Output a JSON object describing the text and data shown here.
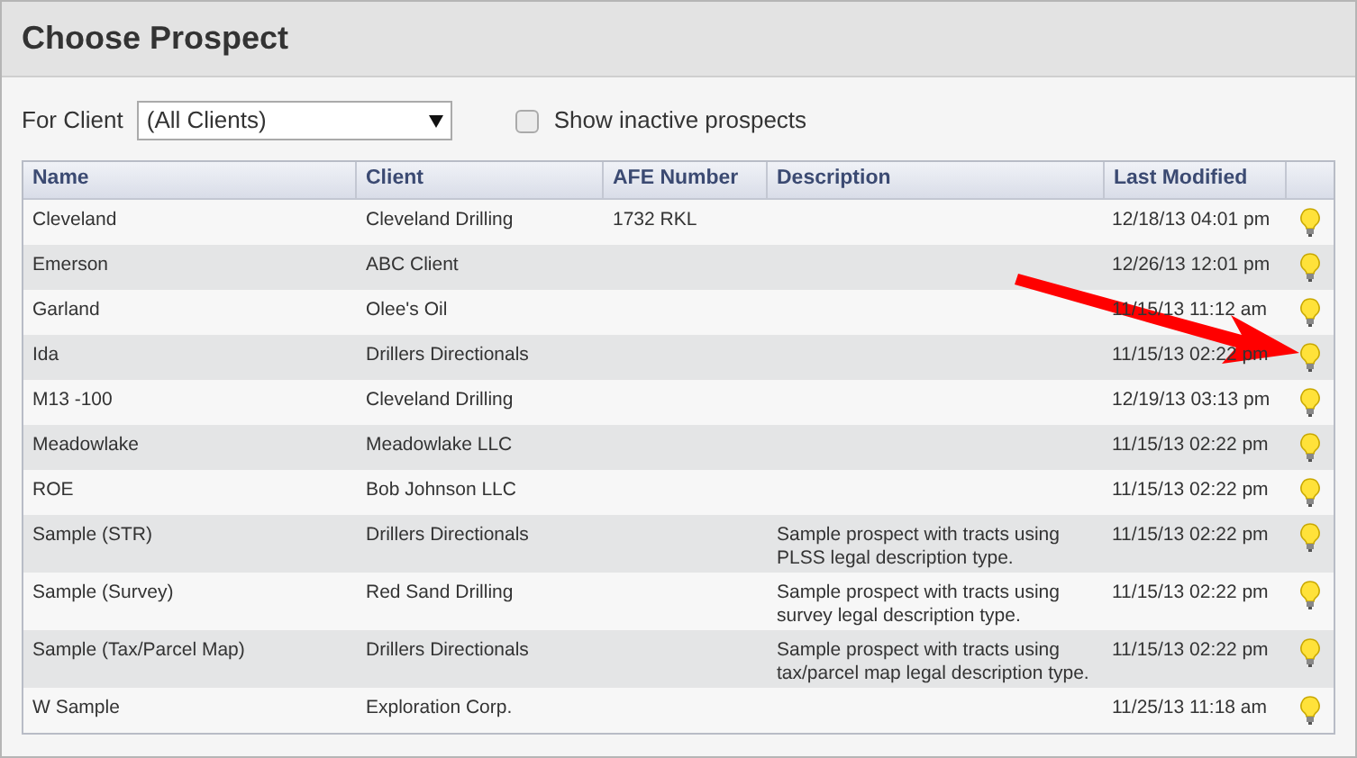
{
  "title": "Choose Prospect",
  "filter": {
    "label": "For Client",
    "value": "(All Clients)",
    "checkbox": {
      "label": "Show inactive prospects",
      "checked": false
    }
  },
  "table": {
    "columns": [
      "Name",
      "Client",
      "AFE Number",
      "Description",
      "Last Modified"
    ],
    "rows": [
      {
        "name": "Cleveland",
        "client": "Cleveland Drilling",
        "afe": "1732 RKL",
        "description": "",
        "modified": "12/18/13 04:01 pm"
      },
      {
        "name": "Emerson",
        "client": "ABC Client",
        "afe": "",
        "description": "",
        "modified": "12/26/13 12:01 pm"
      },
      {
        "name": "Garland",
        "client": "Olee's Oil",
        "afe": "",
        "description": "",
        "modified": "11/15/13 11:12 am"
      },
      {
        "name": "Ida",
        "client": "Drillers Directionals",
        "afe": "",
        "description": "",
        "modified": "11/15/13 02:22 pm"
      },
      {
        "name": "M13 -100",
        "client": "Cleveland Drilling",
        "afe": "",
        "description": "",
        "modified": "12/19/13 03:13 pm"
      },
      {
        "name": "Meadowlake",
        "client": "Meadowlake LLC",
        "afe": "",
        "description": "",
        "modified": "11/15/13 02:22 pm"
      },
      {
        "name": "ROE",
        "client": "Bob Johnson LLC",
        "afe": "",
        "description": "",
        "modified": "11/15/13 02:22 pm"
      },
      {
        "name": "Sample (STR)",
        "client": "Drillers Directionals",
        "afe": "",
        "description": "Sample prospect with tracts using PLSS legal description type.",
        "modified": "11/15/13 02:22 pm"
      },
      {
        "name": "Sample (Survey)",
        "client": "Red Sand Drilling",
        "afe": "",
        "description": "Sample prospect with tracts using survey legal description type.",
        "modified": "11/15/13 02:22 pm"
      },
      {
        "name": "Sample (Tax/Parcel Map)",
        "client": "Drillers Directionals",
        "afe": "",
        "description": "Sample prospect with tracts using tax/parcel map legal description type.",
        "modified": "11/15/13 02:22 pm"
      },
      {
        "name": "W Sample",
        "client": "Exploration Corp.",
        "afe": "",
        "description": "",
        "modified": "11/25/13 11:18 am"
      }
    ]
  }
}
